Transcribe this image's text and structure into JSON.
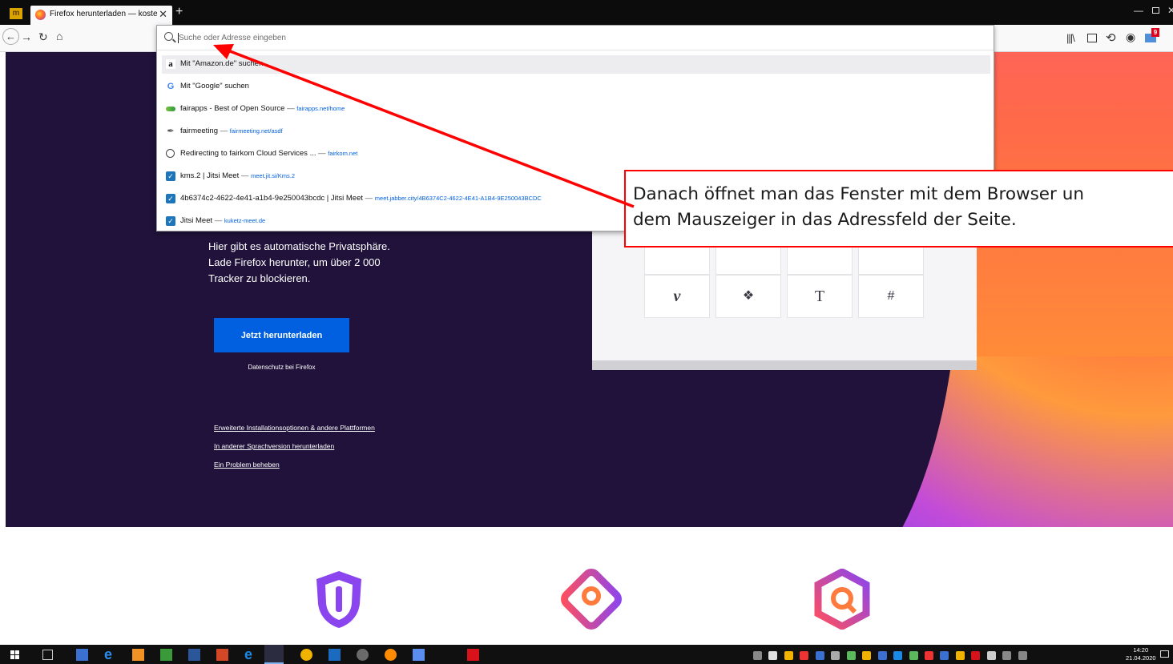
{
  "tab": {
    "title": "Firefox herunterladen — kosten"
  },
  "urlbar": {
    "placeholder": "Suche oder Adresse eingeben",
    "suggestions": [
      {
        "title": "Mit \"Amazon.de\" suchen",
        "url": "",
        "icon": "amazon-icon"
      },
      {
        "title": "Mit \"Google\" suchen",
        "url": "",
        "icon": "google-icon"
      },
      {
        "title": "fairapps - Best of Open Source",
        "url": "fairapps.net/home",
        "icon": "fairapps-icon"
      },
      {
        "title": "fairmeeting",
        "url": "fairmeeting.net/asdf",
        "icon": "feather-icon"
      },
      {
        "title": "Redirecting to fairkom Cloud Services ...",
        "url": "fairkom.net",
        "icon": "globe-icon"
      },
      {
        "title": "kms.2 | Jitsi Meet",
        "url": "meet.jit.si/Kms.2",
        "icon": "jitsi-icon"
      },
      {
        "title": "4b6374c2-4622-4e41-a1b4-9e250043bcdc | Jitsi Meet",
        "url": "meet.jabber.city/4B6374C2-4622-4E41-A1B4-9E250043BCDC",
        "icon": "jitsi-icon"
      },
      {
        "title": "Jitsi Meet",
        "url": "kuketz-meet.de",
        "icon": "jitsi-icon"
      }
    ],
    "separator": "—"
  },
  "toolbar": {
    "mail_badge": "9"
  },
  "page": {
    "hero_lines": [
      "Hier gibt es automatische Privatsphäre.",
      "Lade Firefox herunter, um über 2 000",
      "Tracker zu blockieren."
    ],
    "download_label": "Jetzt herunterladen",
    "privacy_link": "Datenschutz bei Firefox",
    "links": [
      "Erweiterte Installationsoptionen & andere Plattformen",
      "In anderer Sprachversion herunterladen",
      "Ein Problem beheben"
    ]
  },
  "callout": {
    "lines": [
      "Danach öffnet man das Fenster mit dem Browser un",
      "dem Mauszeiger in das Adressfeld der Seite."
    ],
    "border_color": "#ff0000"
  },
  "taskbar": {
    "time": "14:20",
    "date": "21.04.2020"
  },
  "colors": {
    "accent": "#0060df",
    "hero_bg": "#20123a",
    "annotation": "#ff0000"
  }
}
